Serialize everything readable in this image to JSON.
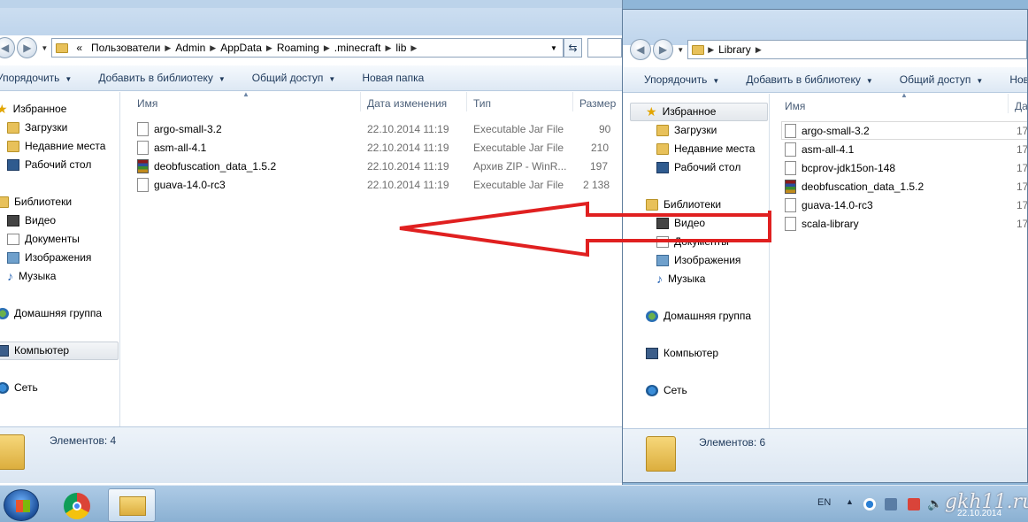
{
  "left_window": {
    "breadcrumb_prefix": "«",
    "breadcrumb": [
      "Пользователи",
      "Admin",
      "AppData",
      "Roaming",
      ".minecraft",
      "lib"
    ],
    "toolbar": [
      "Упорядочить",
      "Добавить в библиотеку",
      "Общий доступ",
      "Новая папка"
    ],
    "columns": [
      "Имя",
      "Дата изменения",
      "Тип",
      "Размер"
    ],
    "files": [
      {
        "name": "argo-small-3.2",
        "date": "22.10.2014 11:19",
        "type": "Executable Jar File",
        "size": "90",
        "icon": "file-icon"
      },
      {
        "name": "asm-all-4.1",
        "date": "22.10.2014 11:19",
        "type": "Executable Jar File",
        "size": "210",
        "icon": "file-icon"
      },
      {
        "name": "deobfuscation_data_1.5.2",
        "date": "22.10.2014 11:19",
        "type": "Архив ZIP - WinR...",
        "size": "197",
        "icon": "winrar-archive-icon"
      },
      {
        "name": "guava-14.0-rc3",
        "date": "22.10.2014 11:19",
        "type": "Executable Jar File",
        "size": "2 138",
        "icon": "file-icon"
      }
    ],
    "status": "Элементов: 4"
  },
  "nav_pane": {
    "favorites": "Избранное",
    "favorites_items": [
      "Загрузки",
      "Недавние места",
      "Рабочий стол"
    ],
    "libraries": "Библиотеки",
    "libraries_items": [
      "Видео",
      "Документы",
      "Изображения",
      "Музыка"
    ],
    "homegroup": "Домашняя группа",
    "computer": "Компьютер",
    "network": "Сеть"
  },
  "right_window": {
    "breadcrumb": [
      "Library"
    ],
    "toolbar": [
      "Упорядочить",
      "Добавить в библиотеку",
      "Общий доступ",
      "Нов"
    ],
    "columns": [
      "Имя",
      "Да"
    ],
    "files": [
      {
        "name": "argo-small-3.2",
        "date": "17.",
        "icon": "file-icon"
      },
      {
        "name": "asm-all-4.1",
        "date": "17.",
        "icon": "file-icon"
      },
      {
        "name": "bcprov-jdk15on-148",
        "date": "17.",
        "icon": "file-icon"
      },
      {
        "name": "deobfuscation_data_1.5.2",
        "date": "17.",
        "icon": "winrar-archive-icon"
      },
      {
        "name": "guava-14.0-rc3",
        "date": "17.",
        "icon": "file-icon"
      },
      {
        "name": "scala-library",
        "date": "17.",
        "icon": "file-icon"
      }
    ],
    "status": "Элементов: 6"
  },
  "taskbar": {
    "language": "EN",
    "date": "22.10.2014",
    "watermark": "gkh11.ru"
  },
  "colors": {
    "arrow": "#e02020",
    "selection": "#e3e7ec",
    "taskbar": "#9fc0df"
  }
}
